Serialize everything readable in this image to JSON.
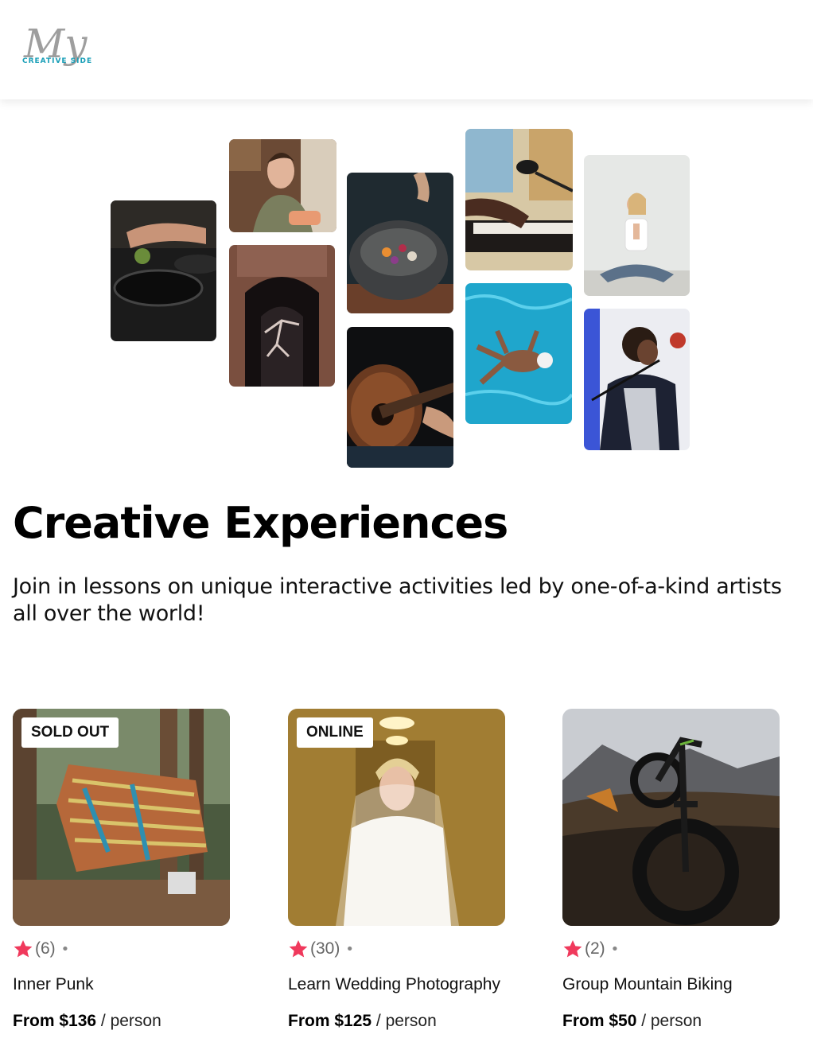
{
  "brand": {
    "logo_script": "My",
    "logo_sub": "CREATIVE SIDE",
    "logo_color": "#9e9e9e",
    "logo_accent": "#1a9fb8"
  },
  "collage": [
    {
      "name": "cooking-pans-photo"
    },
    {
      "name": "baker-woman-photo"
    },
    {
      "name": "dancer-archway-photo"
    },
    {
      "name": "food-bowl-photo"
    },
    {
      "name": "guitar-photo"
    },
    {
      "name": "piano-microphone-photo"
    },
    {
      "name": "swimmer-photo"
    },
    {
      "name": "yoga-woman-photo"
    },
    {
      "name": "singer-photo"
    }
  ],
  "hero": {
    "title": "Creative Experiences",
    "subtitle": "Join in lessons on unique interactive activities led by one-of-a-kind artists all over the world!"
  },
  "cards": [
    {
      "badge": "SOLD OUT",
      "rating_count": "(6)",
      "dot": "•",
      "title": "Inner Punk",
      "price": "From $136",
      "per": " / person"
    },
    {
      "badge": "ONLINE",
      "rating_count": "(30)",
      "dot": "•",
      "title": "Learn Wedding Photography",
      "price": "From $125",
      "per": " / person"
    },
    {
      "badge": "",
      "rating_count": "(2)",
      "dot": "•",
      "title": "Group Mountain Biking",
      "price": "From $50",
      "per": " / person"
    }
  ],
  "colors": {
    "star": "#f0395c"
  }
}
